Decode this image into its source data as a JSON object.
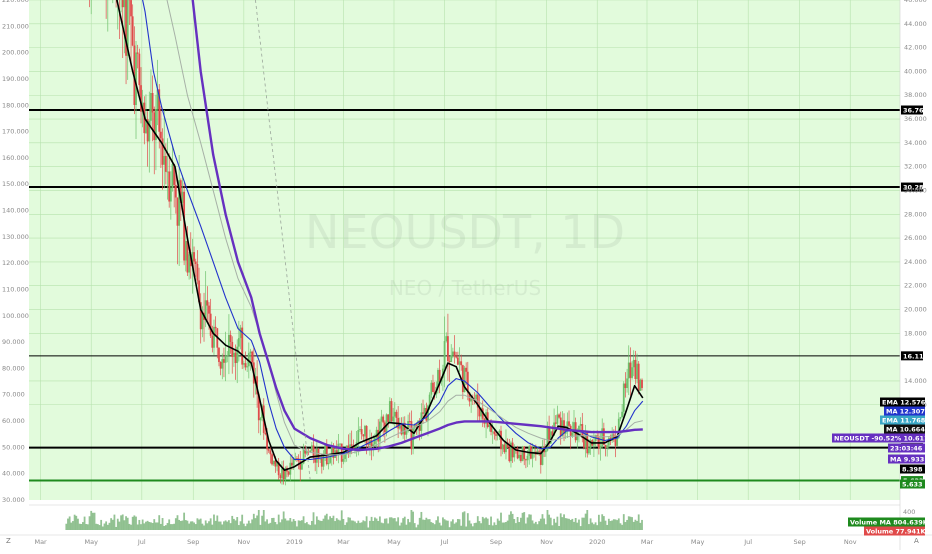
{
  "watermark": {
    "symbol": "NEOUSDT, 1D",
    "pair": "NEO / TetherUS"
  },
  "colors": {
    "plot_bg": "#e2fbdc",
    "grid": "#b6e2ad",
    "up": "#6dc06b",
    "down": "#e04a4a",
    "ema": "#000000",
    "ma_blue": "#2233cc",
    "ma_gray": "#a6b0a6",
    "ma_purple": "#6630c0",
    "support_green": "#1e8a1e",
    "volume": "#6fae6f"
  },
  "bottom_toolbar": {
    "left_icon_label": "Z",
    "right_icon_label": "A"
  },
  "chart_data": {
    "type": "line",
    "title": "NEOUSDT, 1D",
    "subtitle": "NEO / TetherUS",
    "left_axis": {
      "ticks": [
        "220.000",
        "210.000",
        "200.000",
        "190.000",
        "180.000",
        "170.000",
        "160.000",
        "150.000",
        "140.000",
        "130.000",
        "120.000",
        "110.000",
        "100.000",
        "90.000",
        "80.000",
        "70.000",
        "60.000",
        "50.000",
        "40.000",
        "30.000"
      ],
      "range": [
        30,
        220
      ]
    },
    "right_axis": {
      "ticks": [
        "46.000",
        "44.000",
        "42.000",
        "40.000",
        "38.000",
        "36.000",
        "34.000",
        "32.000",
        "30.000",
        "28.000",
        "26.000",
        "24.000",
        "22.000",
        "20.000",
        "18.000",
        "14.000",
        "12.000"
      ],
      "range": [
        4,
        46
      ]
    },
    "x_ticks": [
      "Mar",
      "May",
      "Jul",
      "Sep",
      "Nov",
      "2019",
      "Mar",
      "May",
      "Jul",
      "Sep",
      "Nov",
      "2020",
      "Mar",
      "May",
      "Jul",
      "Sep",
      "Nov"
    ],
    "x_range": [
      "2018-02-15",
      "2020-12-31"
    ],
    "horizontal_levels": [
      {
        "value": 36.76,
        "label": "36.760",
        "style": "bold"
      },
      {
        "value": 30.287,
        "label": "30.287",
        "style": "bold"
      },
      {
        "value": 16.11,
        "label": "16.110",
        "style": "thin"
      },
      {
        "value": 8.398,
        "label": "8.398",
        "style": "bold"
      },
      {
        "value": 5.633,
        "label": "5.633",
        "style": "support"
      }
    ],
    "price_tags": [
      {
        "label": "EMA",
        "value": "12.576",
        "color": "#000000"
      },
      {
        "label": "MA",
        "value": "12.307",
        "color": "#2233cc"
      },
      {
        "label": "EMA",
        "value": "11.768",
        "color": "#3aa6c6"
      },
      {
        "label": "MA",
        "value": "10.664",
        "color": "#111111"
      },
      {
        "label": "NEOUSDT",
        "value": "-90.52%",
        "extra": "10.611",
        "color": "#6630c0"
      },
      {
        "label": "",
        "value": "23:03:46",
        "color": "#6630c0"
      },
      {
        "label": "MA",
        "value": "9.933",
        "color": "#6630c0"
      },
      {
        "label": "",
        "value": "8.398",
        "color": "#000000"
      },
      {
        "label": "",
        "value": "5.633",
        "color": "#1e8a1e"
      }
    ],
    "volume_axis": {
      "ticks": [
        "400",
        "200"
      ]
    },
    "volume_tags": [
      {
        "label": "Volume MA",
        "value": "804.639K",
        "color": "#1e8a1e"
      },
      {
        "label": "Volume",
        "value": "77.941K",
        "color": "#e04a4a"
      }
    ],
    "price_series": {
      "name": "NEOUSDT",
      "dates": [
        "2018-04-01",
        "2018-05-01",
        "2018-06-01",
        "2018-06-20",
        "2018-07-05",
        "2018-07-15",
        "2018-07-25",
        "2018-08-10",
        "2018-08-25",
        "2018-09-10",
        "2018-09-25",
        "2018-10-10",
        "2018-10-25",
        "2018-11-10",
        "2018-11-20",
        "2018-12-01",
        "2018-12-10",
        "2018-12-20",
        "2019-01-01",
        "2019-01-20",
        "2019-02-10",
        "2019-03-01",
        "2019-03-20",
        "2019-04-10",
        "2019-04-25",
        "2019-05-10",
        "2019-05-25",
        "2019-06-10",
        "2019-06-25",
        "2019-07-05",
        "2019-07-15",
        "2019-07-25",
        "2019-08-10",
        "2019-08-25",
        "2019-09-10",
        "2019-09-25",
        "2019-10-10",
        "2019-10-25",
        "2019-11-05",
        "2019-11-15",
        "2019-11-25",
        "2019-12-10",
        "2019-12-25",
        "2020-01-10",
        "2020-01-25",
        "2020-02-05",
        "2020-02-15",
        "2020-02-25"
      ],
      "values": [
        60.0,
        55.0,
        49.0,
        42.0,
        34.8,
        35.5,
        34.0,
        30.5,
        26.0,
        20.0,
        18.0,
        17.0,
        16.6,
        16.0,
        12.0,
        8.0,
        6.8,
        6.0,
        7.2,
        8.0,
        7.8,
        8.0,
        9.4,
        9.6,
        11.3,
        10.2,
        9.2,
        12.0,
        14.8,
        17.2,
        16.0,
        14.0,
        12.0,
        10.0,
        8.5,
        7.8,
        8.0,
        7.6,
        9.6,
        10.8,
        10.2,
        9.4,
        8.6,
        9.0,
        9.5,
        13.8,
        16.0,
        12.6
      ]
    },
    "series": [
      {
        "name": "EMA",
        "color": "#000000",
        "values": [
          58,
          52,
          46,
          40,
          36,
          35,
          34,
          32,
          26,
          20,
          18,
          17,
          16.5,
          15.5,
          12.5,
          9,
          7.3,
          6.5,
          6.8,
          7.6,
          7.8,
          8,
          8.8,
          9.4,
          10.5,
          10.4,
          9.6,
          11.4,
          13.8,
          15.5,
          15.2,
          13.5,
          12,
          10.4,
          9,
          8.2,
          8,
          7.9,
          8.9,
          10.2,
          10.1,
          9.5,
          8.8,
          8.8,
          9.3,
          11.5,
          13.6,
          12.58
        ]
      },
      {
        "name": "MA",
        "color": "#2233cc",
        "values": [
          70,
          64,
          55,
          50,
          45,
          40,
          37,
          33,
          30,
          27,
          24,
          21,
          18.4,
          17.4,
          15.6,
          12.2,
          10,
          8.4,
          7.4,
          7.4,
          7.6,
          7.9,
          8.4,
          9.1,
          9.8,
          10.4,
          10.3,
          11,
          12.2,
          13.6,
          14.2,
          14,
          13,
          11.8,
          10.6,
          9.6,
          8.8,
          8.3,
          8.4,
          9.2,
          9.8,
          9.8,
          9.3,
          9,
          9.2,
          10.2,
          11.5,
          12.31
        ]
      },
      {
        "name": "MA",
        "color": "#a6b0a6",
        "values": [
          90,
          80,
          70,
          64,
          58,
          53,
          48,
          43,
          38,
          34,
          30,
          26,
          22.6,
          20.2,
          18,
          15.6,
          13,
          10.5,
          8.6,
          8,
          7.8,
          7.8,
          8.1,
          8.6,
          9.2,
          9.7,
          10.1,
          10.6,
          11.4,
          12.3,
          12.8,
          12.8,
          12.3,
          11.6,
          10.8,
          10.1,
          9.6,
          9.2,
          9,
          9.1,
          9.3,
          9.4,
          9.4,
          9.3,
          9.4,
          9.9,
          10.5,
          10.66
        ]
      },
      {
        "name": "MA",
        "color": "#6630c0",
        "values": [
          210,
          180,
          150,
          130,
          105,
          90,
          76,
          62,
          50,
          40,
          33,
          28,
          24,
          21,
          18,
          15.5,
          13.4,
          11.5,
          10,
          9.2,
          8.6,
          8.3,
          8.2,
          8.3,
          8.5,
          8.8,
          9.2,
          9.6,
          10,
          10.3,
          10.5,
          10.6,
          10.6,
          10.6,
          10.5,
          10.4,
          10.3,
          10.2,
          10.1,
          10,
          9.9,
          9.8,
          9.7,
          9.7,
          9.7,
          9.8,
          9.9,
          9.93
        ]
      }
    ]
  }
}
